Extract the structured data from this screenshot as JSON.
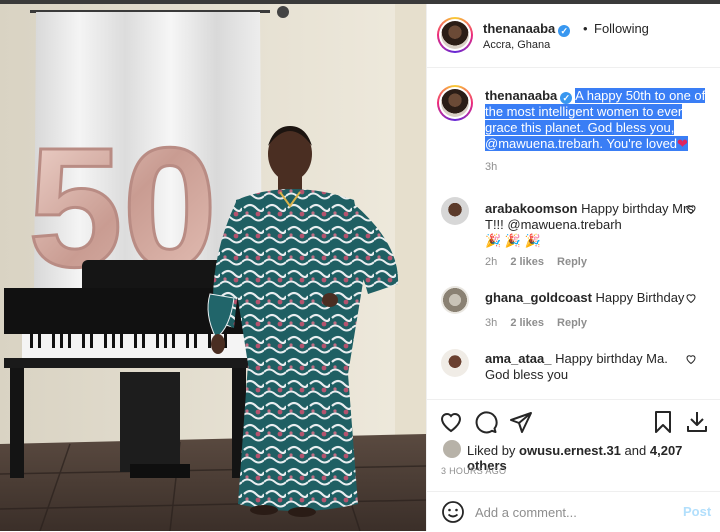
{
  "header": {
    "username": "thenanaaba",
    "separator": "•",
    "follow_status": "Following",
    "location": "Accra, Ghana"
  },
  "caption": {
    "username": "thenanaaba",
    "text": "A happy 50th to one of the most intelligent women to ever grace this planet. God bless you, @mawuena.trebarh. You're loved",
    "emoji": "❤",
    "time": "3h"
  },
  "comments": [
    {
      "username": "arabakoomson",
      "text": "Happy birthday Mrs T!!! @mawuena.trebarh",
      "emoji": "🎉 🎉 🎉",
      "time": "2h",
      "likes": "2 likes",
      "reply": "Reply"
    },
    {
      "username": "ghana_goldcoast",
      "text": "Happy Birthday",
      "time": "3h",
      "likes": "2 likes",
      "reply": "Reply"
    },
    {
      "username": "ama_ataa_",
      "text": "Happy birthday Ma. God bless you"
    }
  ],
  "likes": {
    "prefix": "Liked by",
    "user": "owusu.ernest.31",
    "middle": "and",
    "others": "4,207 others"
  },
  "posted_ago": "3 HOURS AGO",
  "add_comment": {
    "placeholder": "Add a comment...",
    "post_label": "Post"
  },
  "photo": {
    "balloon_text": "50"
  },
  "colors": {
    "accent_blue": "#3897f0",
    "selection": "#3a7ef5",
    "heart": "#e0245e",
    "muted": "#8e8e8e",
    "post_disabled": "#b2dffc"
  }
}
